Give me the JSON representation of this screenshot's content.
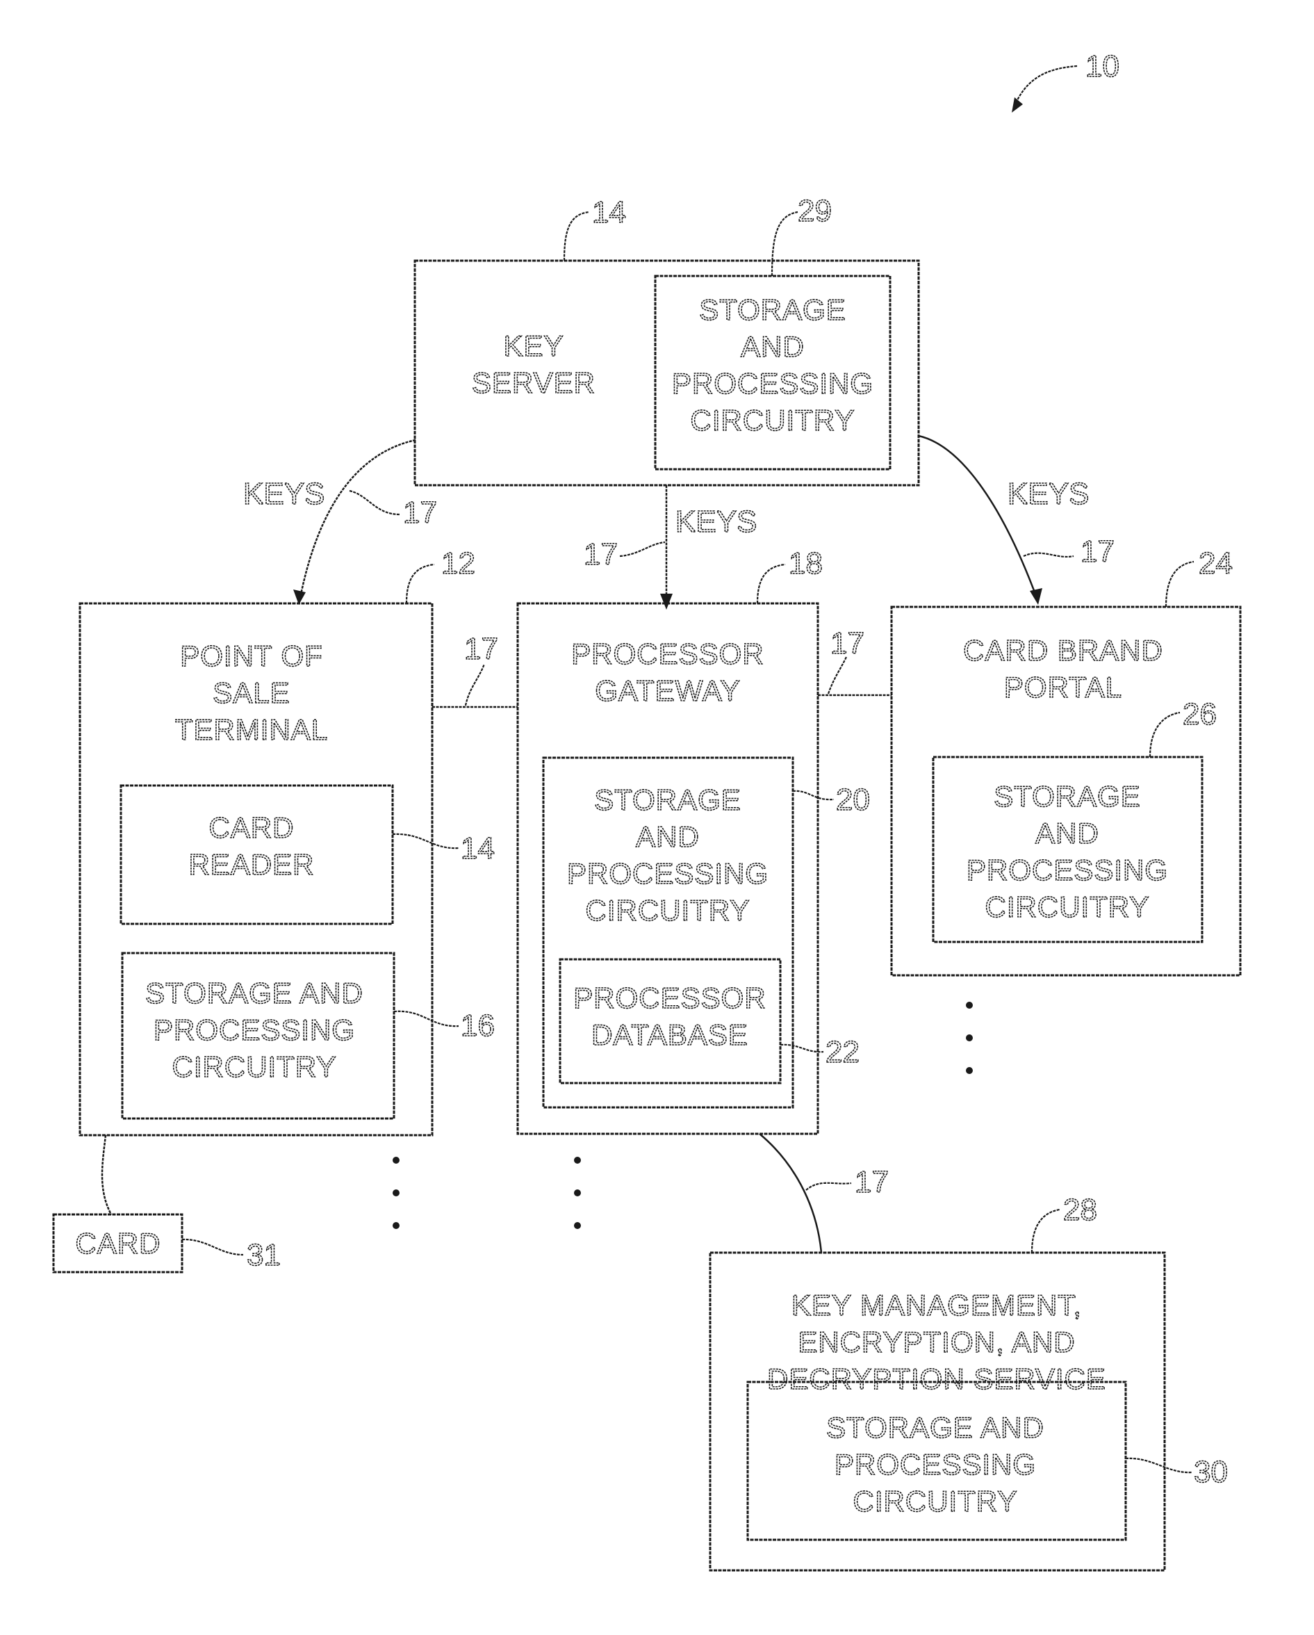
{
  "figure": {
    "reference": "10"
  },
  "key_server": {
    "ref": "14",
    "title_lines": [
      "KEY",
      "SERVER"
    ],
    "circuitry": {
      "ref": "29",
      "lines": [
        "STORAGE",
        "AND",
        "PROCESSING",
        "CIRCUITRY"
      ]
    }
  },
  "links": {
    "keys_label": "KEYS",
    "ref": "17"
  },
  "point_of_sale": {
    "ref": "12",
    "title_lines": [
      "POINT OF",
      "SALE",
      "TERMINAL"
    ],
    "card_reader": {
      "ref": "14",
      "lines": [
        "CARD",
        "READER"
      ]
    },
    "circuitry": {
      "ref": "16",
      "lines": [
        "STORAGE AND",
        "PROCESSING",
        "CIRCUITRY"
      ]
    }
  },
  "processor_gateway": {
    "ref": "18",
    "title_lines": [
      "PROCESSOR",
      "GATEWAY"
    ],
    "circuitry": {
      "ref": "20",
      "lines": [
        "STORAGE",
        "AND",
        "PROCESSING",
        "CIRCUITRY"
      ]
    },
    "database": {
      "ref": "22",
      "lines": [
        "PROCESSOR",
        "DATABASE"
      ]
    }
  },
  "card_brand_portal": {
    "ref": "24",
    "title_lines": [
      "CARD BRAND",
      "PORTAL"
    ],
    "circuitry": {
      "ref": "26",
      "lines": [
        "STORAGE",
        "AND",
        "PROCESSING",
        "CIRCUITRY"
      ]
    }
  },
  "key_management": {
    "ref": "28",
    "title_lines": [
      "KEY MANAGEMENT,",
      "ENCRYPTION, AND",
      "DECRYPTION SERVICE"
    ],
    "circuitry": {
      "ref": "30",
      "lines": [
        "STORAGE AND",
        "PROCESSING",
        "CIRCUITRY"
      ]
    }
  },
  "card": {
    "ref": "31",
    "label": "CARD"
  }
}
